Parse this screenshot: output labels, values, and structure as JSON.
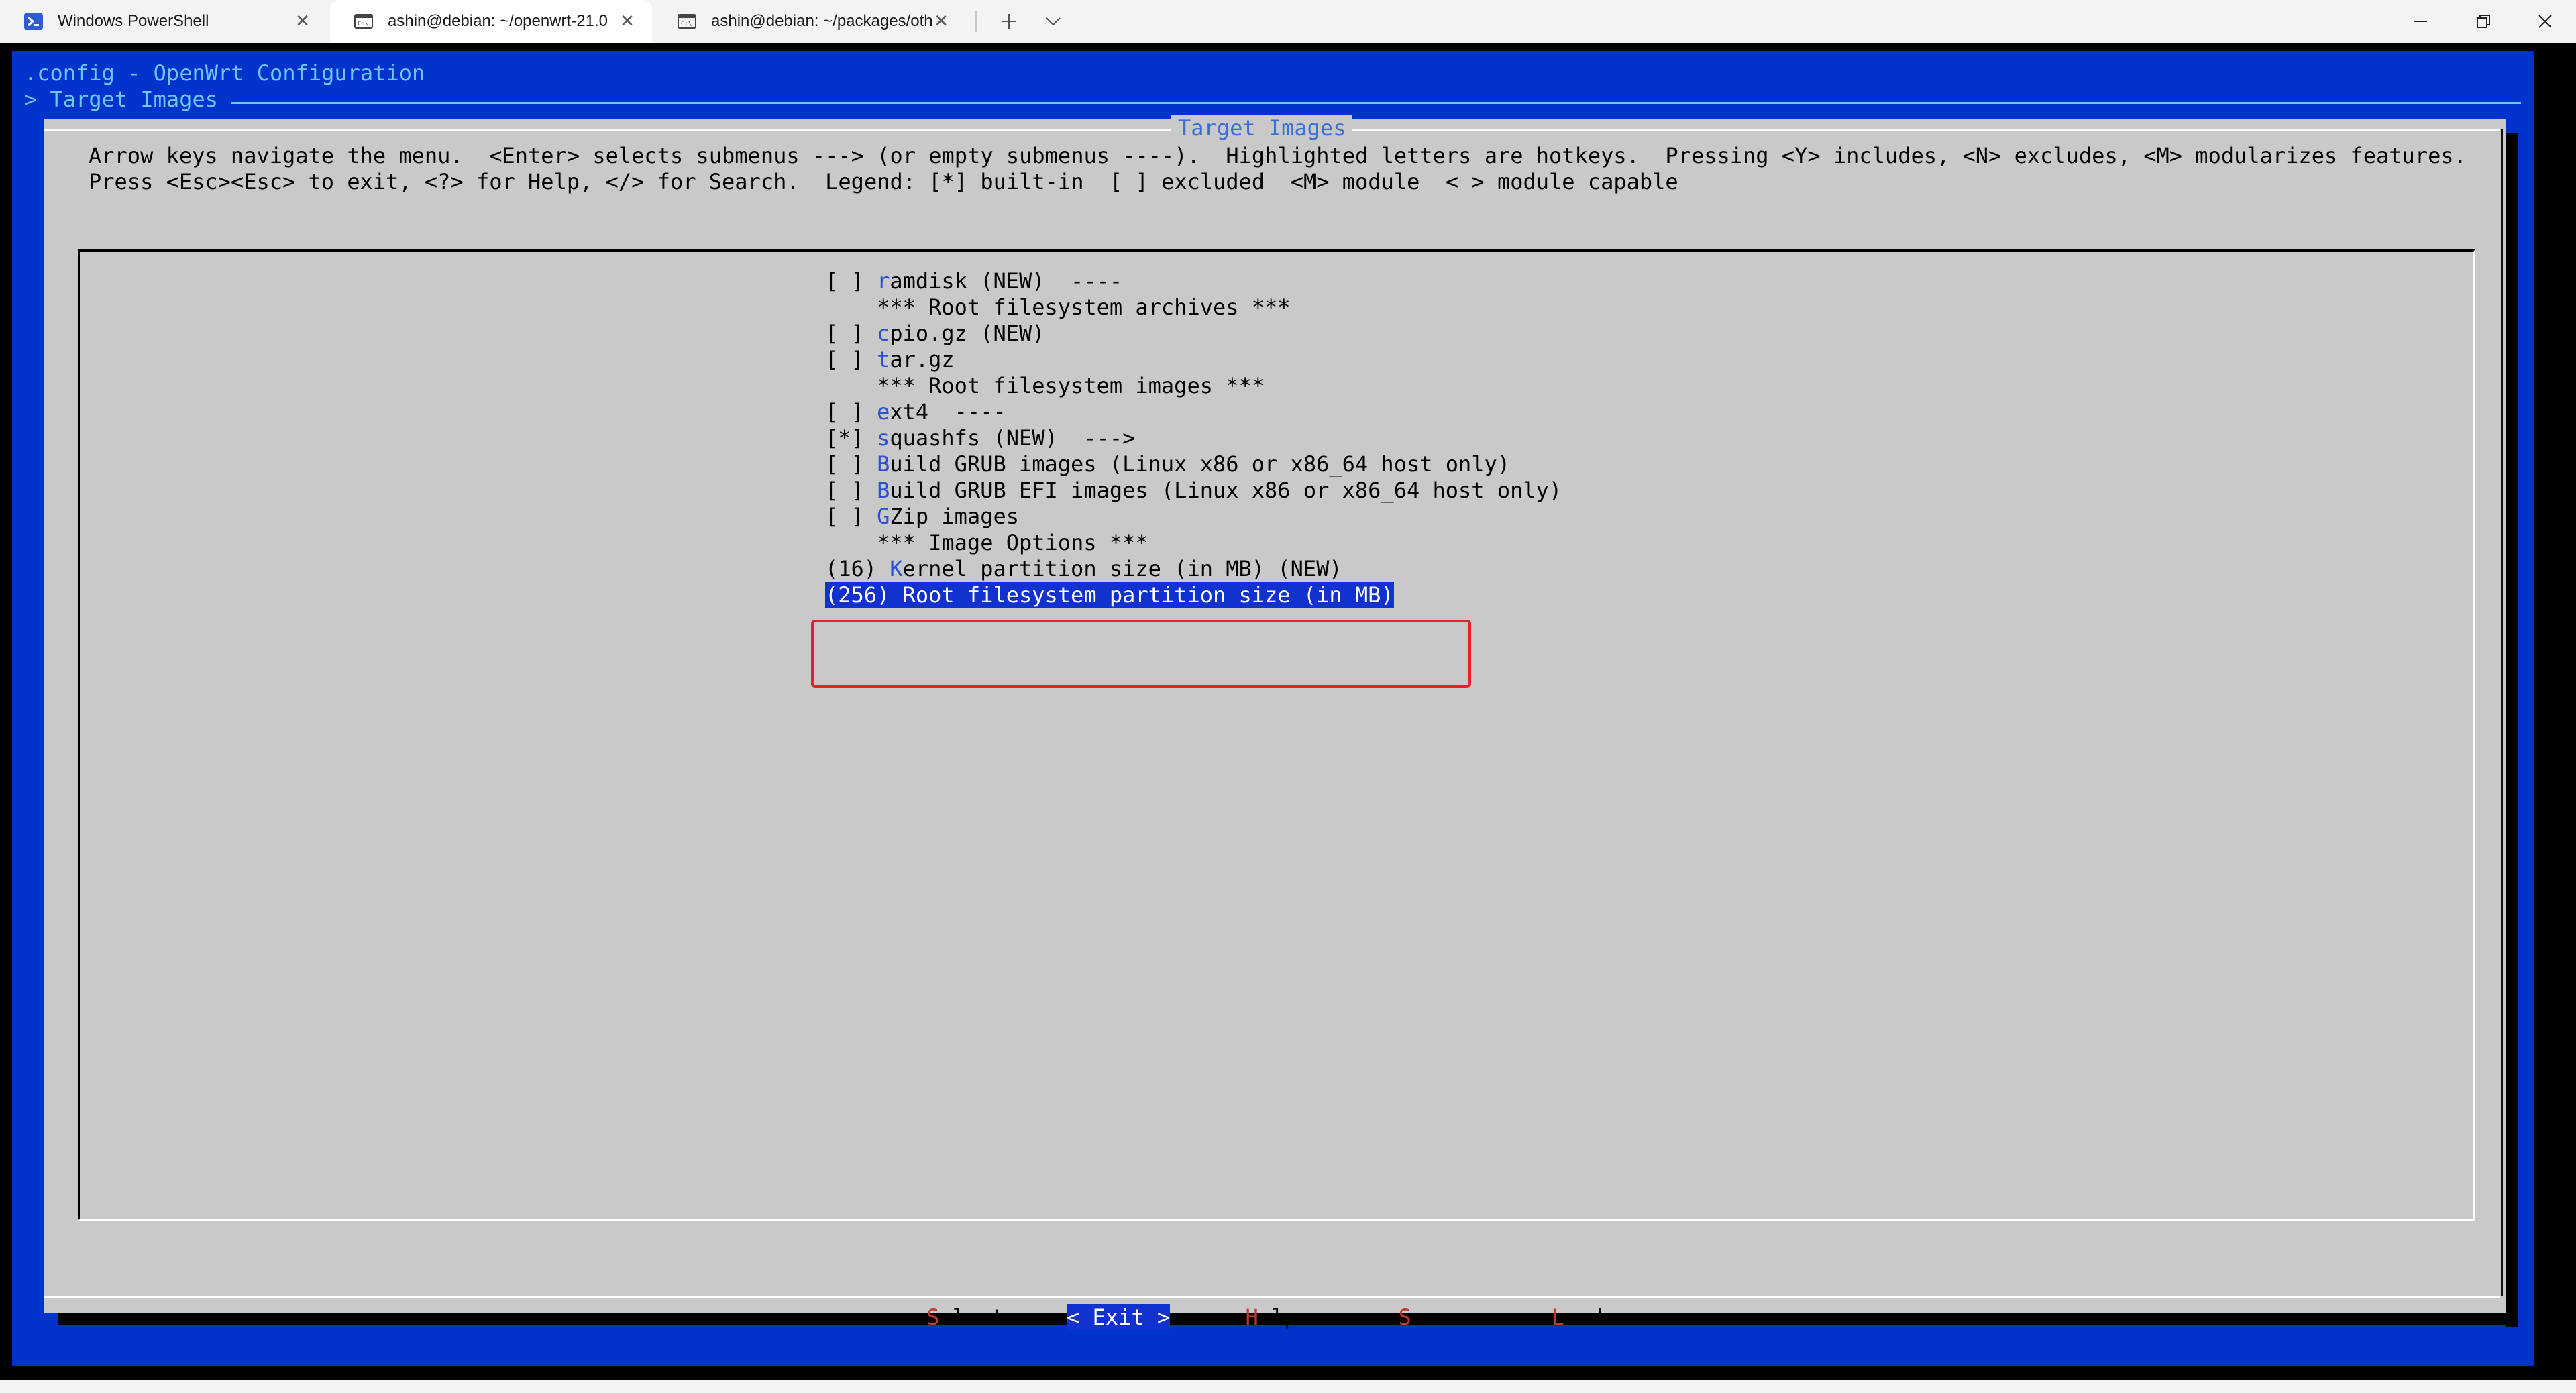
{
  "tabs": [
    {
      "label": "Windows PowerShell",
      "icon": "powershell-icon",
      "active": false
    },
    {
      "label": "ashin@debian: ~/openwrt-21.0",
      "icon": "terminal-icon",
      "active": true
    },
    {
      "label": "ashin@debian: ~/packages/oth",
      "icon": "terminal-icon",
      "active": false
    }
  ],
  "window_controls": {
    "minimize": "—",
    "maximize": "❐",
    "close": "✕"
  },
  "header": {
    "title": ".config - OpenWrt Configuration",
    "breadcrumb": "> Target Images"
  },
  "dialog": {
    "title": "Target Images",
    "help_line1": "Arrow keys navigate the menu.  <Enter> selects submenus ---> (or empty submenus ----).  Highlighted letters are hotkeys.  Pressing <Y> includes, <N> excludes, <M> modularizes features.",
    "help_line2": "Press <Esc><Esc> to exit, <?> for Help, </> for Search.  Legend: [*] built-in  [ ] excluded  <M> module  < > module capable"
  },
  "menu": {
    "items": [
      {
        "prefix": "[ ] ",
        "hotkey": "r",
        "rest": "amdisk (NEW)  ----"
      },
      {
        "prefix": "    ",
        "hotkey": "",
        "rest": "*** Root filesystem archives ***"
      },
      {
        "prefix": "[ ] ",
        "hotkey": "c",
        "rest": "pio.gz (NEW)"
      },
      {
        "prefix": "[ ] ",
        "hotkey": "t",
        "rest": "ar.gz"
      },
      {
        "prefix": "    ",
        "hotkey": "",
        "rest": "*** Root filesystem images ***"
      },
      {
        "prefix": "[ ] ",
        "hotkey": "e",
        "rest": "xt4  ----"
      },
      {
        "prefix": "[*] ",
        "hotkey": "s",
        "rest": "quashfs (NEW)  --->"
      },
      {
        "prefix": "[ ] ",
        "hotkey": "B",
        "rest": "uild GRUB images (Linux x86 or x86_64 host only)"
      },
      {
        "prefix": "[ ] ",
        "hotkey": "B",
        "rest": "uild GRUB EFI images (Linux x86 or x86_64 host only)"
      },
      {
        "prefix": "[ ] ",
        "hotkey": "G",
        "rest": "Zip images"
      },
      {
        "prefix": "    ",
        "hotkey": "",
        "rest": "*** Image Options ***"
      },
      {
        "prefix": "(16) ",
        "hotkey": "K",
        "rest": "ernel partition size (in MB) (NEW)"
      }
    ],
    "selected": "(256) Root filesystem partition size (in MB)"
  },
  "buttons": {
    "select": {
      "open": "<",
      "hotkey": "S",
      "rest": "elect",
      "close": ">"
    },
    "exit": {
      "label": "< Exit >"
    },
    "help": {
      "open": "< ",
      "hotkey": "H",
      "rest": "elp",
      "close": " >"
    },
    "save": {
      "open": "< ",
      "hotkey": "S",
      "rest": "ave",
      "close": " >"
    },
    "load": {
      "open": "< ",
      "hotkey": "L",
      "rest": "oad",
      "close": " >"
    }
  }
}
